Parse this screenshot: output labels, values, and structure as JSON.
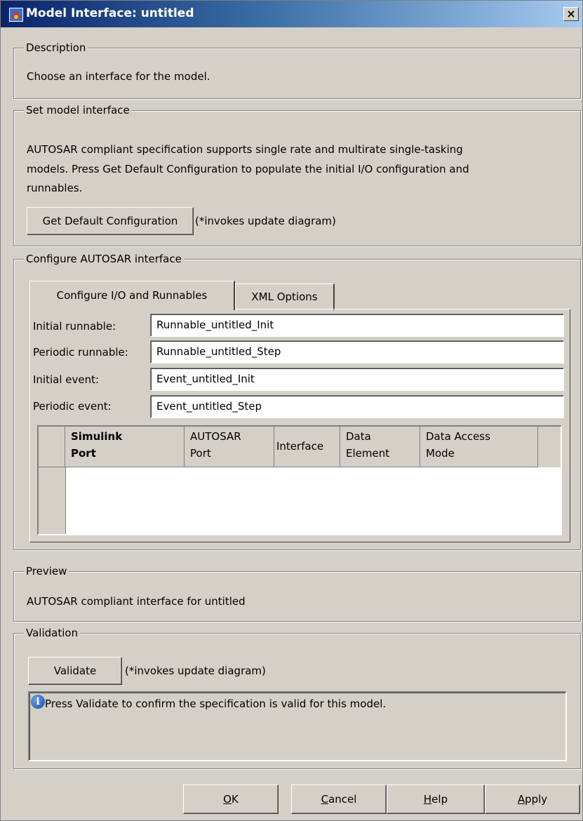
{
  "window": {
    "title": "Model Interface: untitled",
    "close_label": "×"
  },
  "description": {
    "legend": "Description",
    "text": "Choose an interface for the model."
  },
  "set_model_interface": {
    "legend": "Set model interface",
    "text_lines": [
      "AUTOSAR compliant specification supports single rate and multirate single-tasking",
      "models. Press Get Default Configuration to populate the initial I/O configuration and",
      "runnables."
    ],
    "button_label": "Get Default Configuration",
    "note": "(*invokes update diagram)"
  },
  "configure": {
    "legend": "Configure AUTOSAR interface",
    "tabs": [
      "Configure I/O and Runnables",
      "XML Options"
    ],
    "fields": [
      {
        "label": "Initial runnable:",
        "value": "Runnable_untitled_Init"
      },
      {
        "label": "Periodic runnable:",
        "value": "Runnable_untitled_Step"
      },
      {
        "label": "Initial event:",
        "value": "Event_untitled_Init"
      },
      {
        "label": "Periodic event:",
        "value": "Event_untitled_Step"
      }
    ],
    "table": {
      "headers": [
        {
          "line1": "Simulink",
          "line2": "Port"
        },
        {
          "line1": "AUTOSAR",
          "line2": "Port"
        },
        {
          "line1": "Interface",
          "line2": ""
        },
        {
          "line1": "Data",
          "line2": "Element"
        },
        {
          "line1": "Data Access",
          "line2": "Mode"
        }
      ],
      "rows": []
    }
  },
  "preview": {
    "legend": "Preview",
    "text": "AUTOSAR compliant interface for untitled"
  },
  "validation": {
    "legend": "Validation",
    "button_label": "Validate",
    "note": "(*invokes update diagram)",
    "message": "Press Validate to confirm the specification is valid for this model."
  },
  "footer": {
    "ok": {
      "underline": "O",
      "rest": "K"
    },
    "cancel": {
      "underline": "C",
      "rest": "ancel"
    },
    "help": {
      "underline": "H",
      "rest": "elp"
    },
    "apply": {
      "underline": "A",
      "rest": "pply"
    }
  },
  "icons": {
    "app": "simulink-app-icon",
    "info": "info-icon",
    "close": "close-icon"
  }
}
